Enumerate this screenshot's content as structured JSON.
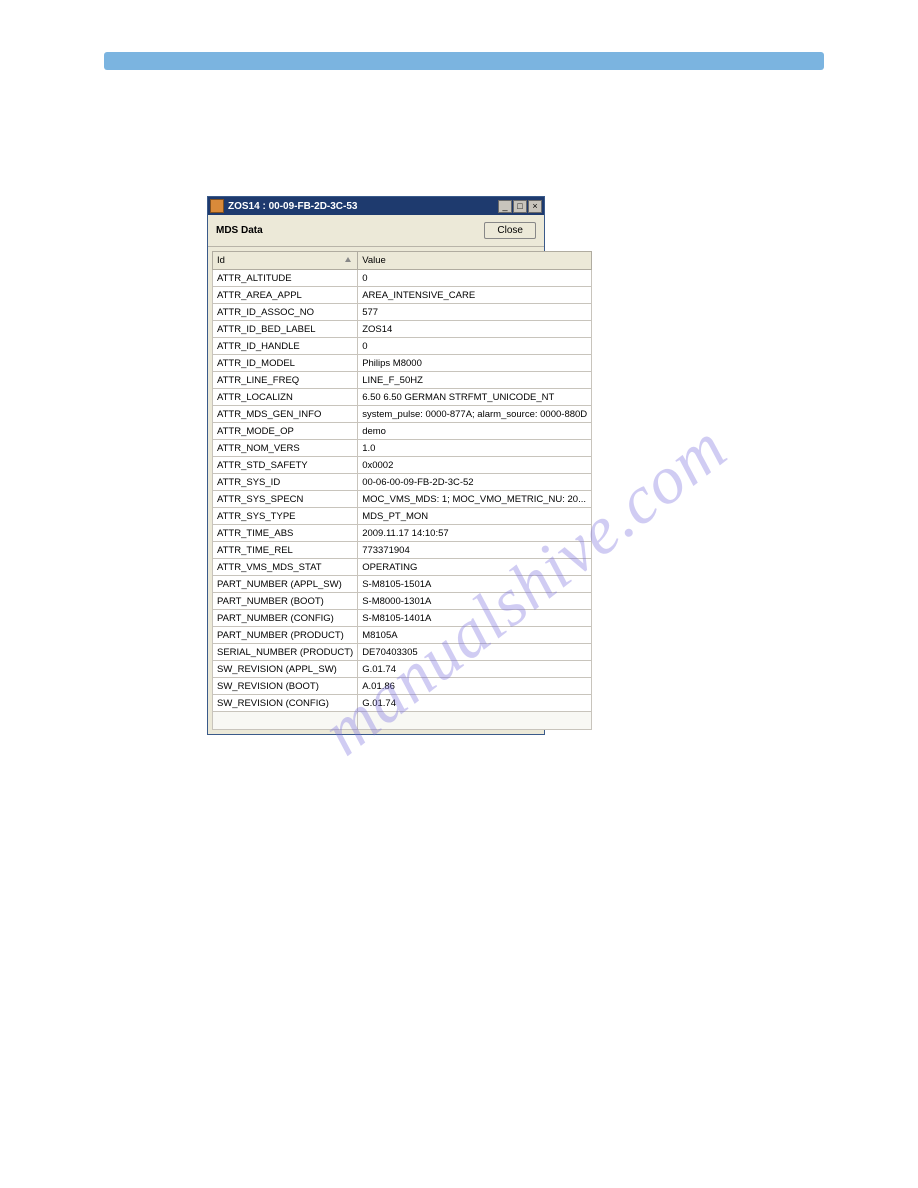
{
  "window": {
    "title": "ZOS14 : 00-09-FB-2D-3C-53",
    "toolbar_title": "MDS Data",
    "close_label": "Close"
  },
  "table": {
    "headers": {
      "id": "Id",
      "value": "Value"
    },
    "rows": [
      {
        "id": "ATTR_ALTITUDE",
        "value": "0"
      },
      {
        "id": "ATTR_AREA_APPL",
        "value": "AREA_INTENSIVE_CARE"
      },
      {
        "id": "ATTR_ID_ASSOC_NO",
        "value": "577"
      },
      {
        "id": "ATTR_ID_BED_LABEL",
        "value": "ZOS14"
      },
      {
        "id": "ATTR_ID_HANDLE",
        "value": "0"
      },
      {
        "id": "ATTR_ID_MODEL",
        "value": "Philips M8000"
      },
      {
        "id": "ATTR_LINE_FREQ",
        "value": "LINE_F_50HZ"
      },
      {
        "id": "ATTR_LOCALIZN",
        "value": "6.50 6.50 GERMAN STRFMT_UNICODE_NT"
      },
      {
        "id": "ATTR_MDS_GEN_INFO",
        "value": "system_pulse: 0000-877A; alarm_source: 0000-880D"
      },
      {
        "id": "ATTR_MODE_OP",
        "value": "demo"
      },
      {
        "id": "ATTR_NOM_VERS",
        "value": "1.0"
      },
      {
        "id": "ATTR_STD_SAFETY",
        "value": "0x0002"
      },
      {
        "id": "ATTR_SYS_ID",
        "value": "00-06-00-09-FB-2D-3C-52"
      },
      {
        "id": "ATTR_SYS_SPECN",
        "value": "MOC_VMS_MDS: 1; MOC_VMO_METRIC_NU: 20..."
      },
      {
        "id": "ATTR_SYS_TYPE",
        "value": "MDS_PT_MON"
      },
      {
        "id": "ATTR_TIME_ABS",
        "value": "2009.11.17 14:10:57"
      },
      {
        "id": "ATTR_TIME_REL",
        "value": "773371904"
      },
      {
        "id": "ATTR_VMS_MDS_STAT",
        "value": "OPERATING"
      },
      {
        "id": "PART_NUMBER (APPL_SW)",
        "value": "S-M8105-1501A"
      },
      {
        "id": "PART_NUMBER (BOOT)",
        "value": "S-M8000-1301A"
      },
      {
        "id": "PART_NUMBER (CONFIG)",
        "value": "S-M8105-1401A"
      },
      {
        "id": "PART_NUMBER (PRODUCT)",
        "value": "M8105A"
      },
      {
        "id": "SERIAL_NUMBER (PRODUCT)",
        "value": "DE70403305"
      },
      {
        "id": "SW_REVISION (APPL_SW)",
        "value": "G.01.74"
      },
      {
        "id": "SW_REVISION (BOOT)",
        "value": "A.01.86"
      },
      {
        "id": "SW_REVISION (CONFIG)",
        "value": "G.01.74"
      }
    ]
  },
  "watermark": "manualshive.com"
}
